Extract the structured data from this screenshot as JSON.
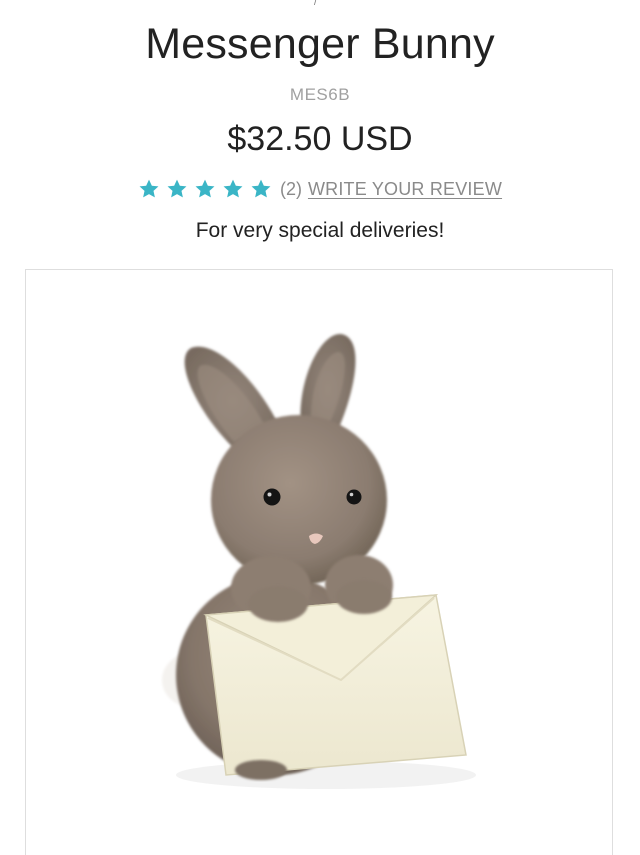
{
  "product": {
    "title": "Messenger Bunny",
    "sku": "MES6B",
    "price": "$32.50 USD",
    "rating": {
      "stars": 5,
      "max_stars": 5,
      "star_color": "#3ab5c6",
      "count_text": "(2)",
      "write_review_label": "WRITE YOUR REVIEW"
    },
    "tagline": "For very special deliveries!"
  },
  "image": {
    "icon": "plush-bunny-with-envelope"
  }
}
